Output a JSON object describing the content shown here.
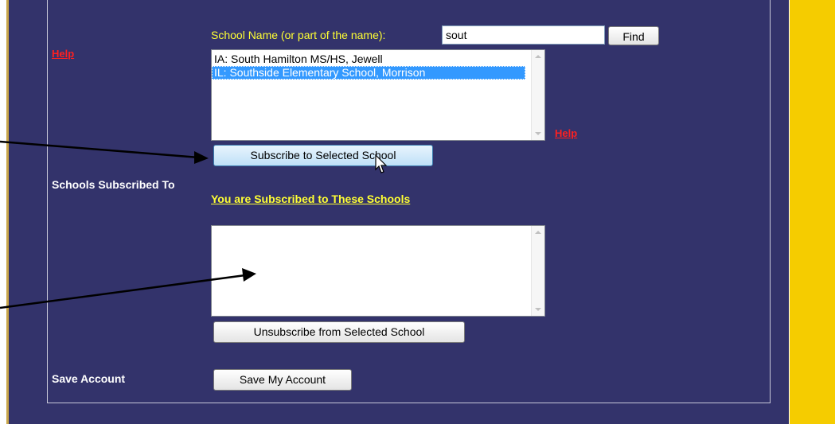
{
  "colors": {
    "panel_bg": "#33336b",
    "accent_yellow": "#f5cc00",
    "label_yellow": "#ffff33",
    "help_red": "#ff2020",
    "selection_blue": "#3399ff"
  },
  "help_links": [
    "Help",
    "Help"
  ],
  "search": {
    "label": "School Name (or part of the name):",
    "value": "sout",
    "find_button": "Find"
  },
  "results": {
    "items": [
      {
        "label": "IA: South Hamilton MS/HS, Jewell",
        "selected": false
      },
      {
        "label": "IL: Southside Elementary School, Morrison",
        "selected": true
      }
    ],
    "subscribe_button": "Subscribe to Selected School"
  },
  "subscriptions": {
    "section_label": "Schools Subscribed To",
    "heading": "You are Subscribed to These Schools",
    "items": [],
    "unsubscribe_button": "Unsubscribe from Selected School"
  },
  "account": {
    "section_label": "Save Account",
    "save_button": "Save My Account"
  },
  "icons": {
    "cursor": "mouse-pointer-icon",
    "scroll_up": "scroll-up-arrow-icon",
    "scroll_down": "scroll-down-arrow-icon",
    "annotation": "annotation-arrow-icon"
  }
}
